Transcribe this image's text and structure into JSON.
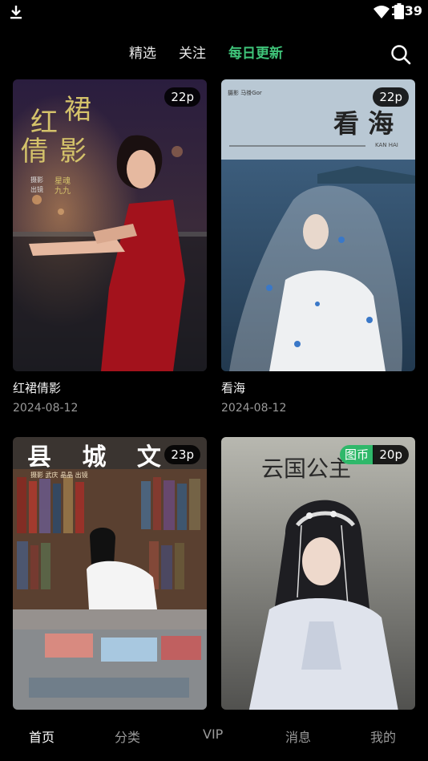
{
  "status_bar": {
    "time": "1:39"
  },
  "top_tabs": [
    {
      "label": "精选"
    },
    {
      "label": "关注"
    },
    {
      "label": "每日更新"
    }
  ],
  "cards": [
    {
      "title": "红裙倩影",
      "date": "2024-08-12",
      "count": "22p",
      "poster_lines": [
        "红",
        "裙",
        "倩",
        "影"
      ],
      "poster_credits": [
        "摄影",
        "星魂",
        "出镜",
        "九九"
      ]
    },
    {
      "title": "看海",
      "date": "2024-08-12",
      "count": "22p",
      "poster_title": "看 海",
      "poster_sub": "KAN HAI",
      "poster_credit": "摄影 马褂Gor"
    },
    {
      "title": "",
      "date": "",
      "count": "23p",
      "poster_title": "县 城 文",
      "poster_credits": "摄影 武庆  晶晶 出镜"
    },
    {
      "title": "",
      "date": "",
      "count": "20p",
      "coin_badge": "图币",
      "poster_title": "云国公主"
    }
  ],
  "bottom_nav": [
    {
      "label": "首页"
    },
    {
      "label": "分类"
    },
    {
      "label": "VIP"
    },
    {
      "label": "消息"
    },
    {
      "label": "我的"
    }
  ],
  "colors": {
    "accent": "#3fc479",
    "coin_badge": "#2fb86a",
    "background": "#000000"
  },
  "icons": [
    "download-icon",
    "wifi-icon",
    "battery-icon",
    "search-icon"
  ]
}
